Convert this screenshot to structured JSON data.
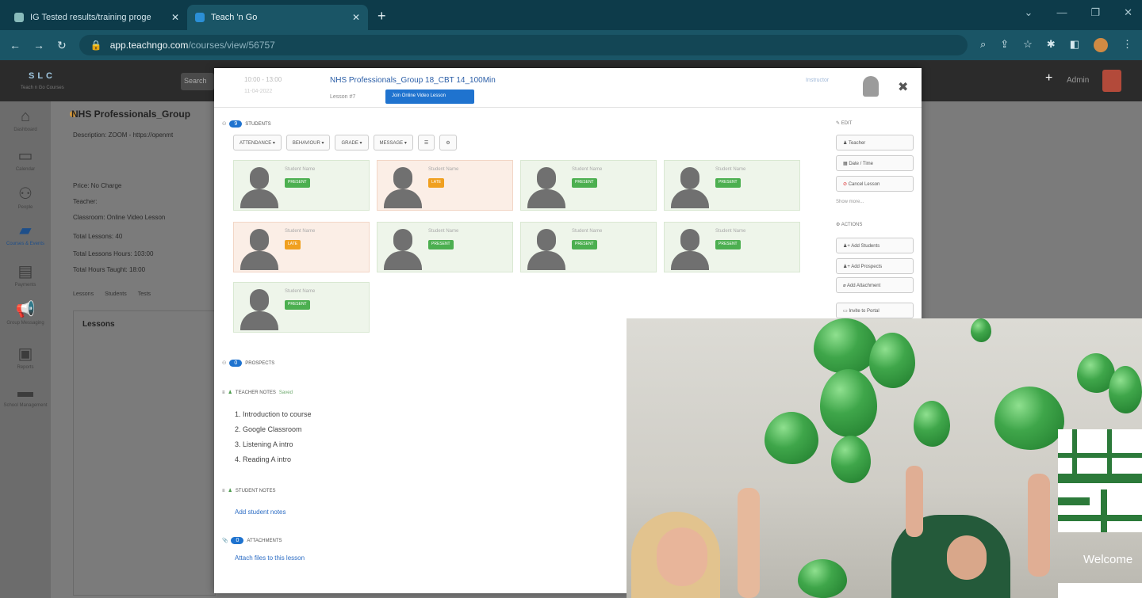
{
  "browser": {
    "tabs": [
      {
        "title": "IG Tested results/training proge"
      },
      {
        "title": "Teach 'n Go"
      }
    ],
    "new_tab": "+",
    "window_controls": [
      "⌄",
      "—",
      "❐",
      "✕"
    ],
    "address": {
      "host": "app.teachngo.com",
      "path": "/courses/view/56757"
    }
  },
  "appbar": {
    "logo": "SLC",
    "logo_sub": "Teach n Go Courses",
    "search_label": "Search",
    "plus": "+",
    "username": "Admin"
  },
  "sidebar": {
    "items": [
      {
        "label": "Dashboard",
        "icon": "home-icon"
      },
      {
        "label": "Calendar",
        "icon": "calendar-icon"
      },
      {
        "label": "People",
        "icon": "people-icon"
      },
      {
        "label": "Courses & Events",
        "icon": "book-icon"
      },
      {
        "label": "Payments",
        "icon": "card-icon"
      },
      {
        "label": "Group Messaging",
        "icon": "megaphone-icon"
      },
      {
        "label": "Reports",
        "icon": "report-icon"
      },
      {
        "label": "School Management",
        "icon": "briefcase-icon"
      }
    ]
  },
  "background_page": {
    "title": "NHS Professionals_Group",
    "description": "Description: ZOOM - https://openmt",
    "lines": [
      "Price: No Charge",
      "Teacher:",
      "Classroom: Online Video Lesson",
      "Total Lessons: 40",
      "Total Lessons Hours: 103:00",
      "Total Hours Taught: 18:00"
    ],
    "tabs": [
      "Lessons",
      "Students",
      "Tests"
    ],
    "section_heading": "Lessons"
  },
  "modal": {
    "time": "10:00 - 13:00",
    "date": "11-04-2022",
    "course_name": "NHS Professionals_Group 18_CBT 14_100Min",
    "lesson_number": "Lesson #7",
    "start_button": "Join Online Video Lesson",
    "instructor": "Instructor",
    "close": "✖",
    "students": {
      "label": "STUDENTS",
      "count": "9",
      "filters": [
        "ATTENDANCE ▾",
        "BEHAVIOUR ▾",
        "GRADE ▾",
        "MESSAGE ▾",
        "☰",
        "⚙"
      ],
      "cards": [
        {
          "name": "Student Name",
          "status": "PRESENT",
          "late": false
        },
        {
          "name": "Student Name",
          "status": "LATE",
          "late": true
        },
        {
          "name": "Student Name",
          "status": "PRESENT",
          "late": false
        },
        {
          "name": "Student Name",
          "status": "PRESENT",
          "late": false
        },
        {
          "name": "Student Name",
          "status": "LATE",
          "late": true
        },
        {
          "name": "Student Name",
          "status": "PRESENT",
          "late": false
        },
        {
          "name": "Student Name",
          "status": "PRESENT",
          "late": false
        },
        {
          "name": "Student Name",
          "status": "PRESENT",
          "late": false
        },
        {
          "name": "Student Name",
          "status": "PRESENT",
          "late": false
        }
      ]
    },
    "prospects": {
      "label": "PROSPECTS",
      "count": "0"
    },
    "teacher_notes": {
      "label": "TEACHER NOTES",
      "tag": "Saved",
      "items": [
        "1. Introduction to course",
        "2. Google Classroom",
        "3. Listening A intro",
        "4. Reading A intro"
      ]
    },
    "student_notes": {
      "label": "STUDENT NOTES",
      "link": "Add student notes"
    },
    "attachments": {
      "label": "ATTACHMENTS",
      "count": "0",
      "link": "Attach files to this lesson"
    },
    "right_panel": {
      "edit_label": "EDIT",
      "edit_buttons": [
        "Teacher",
        "Date / Time",
        "Cancel Lesson"
      ],
      "show_more": "Show more...",
      "actions_label": "ACTIONS",
      "action_buttons": [
        "Add Students",
        "Add Prospects",
        "Add Attachment",
        "Invite to Portal"
      ]
    }
  },
  "video": {
    "welcome": "Welcome"
  }
}
